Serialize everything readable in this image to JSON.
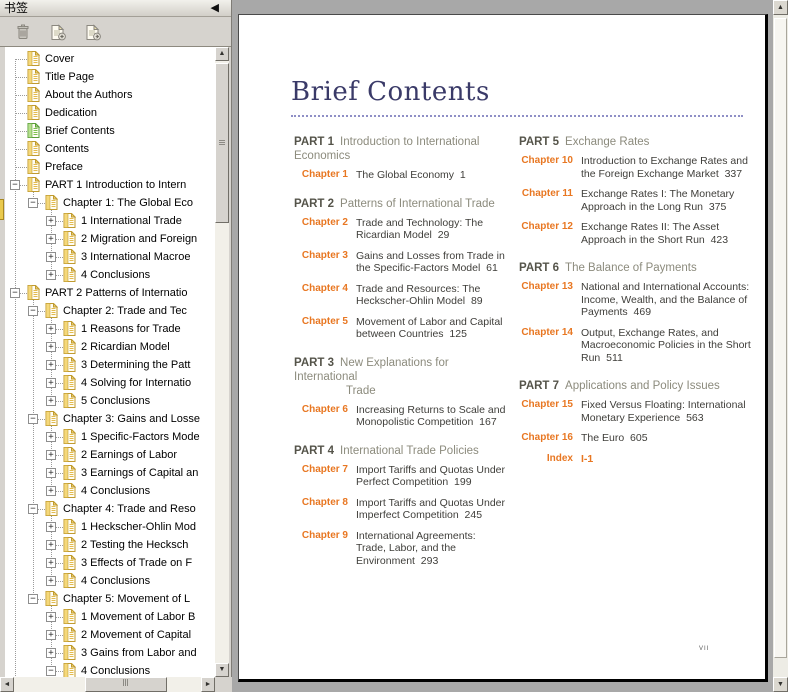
{
  "panel": {
    "title": "书签",
    "collapse_glyph": "◀",
    "toolbar_icons": [
      "delete-bookmark-icon",
      "add-bookmark-icon",
      "export-bookmark-icon"
    ],
    "tree": [
      {
        "label": "Cover",
        "level": 0,
        "expand": null
      },
      {
        "label": "Title Page",
        "level": 0,
        "expand": null
      },
      {
        "label": "About the Authors",
        "level": 0,
        "expand": null
      },
      {
        "label": "Dedication",
        "level": 0,
        "expand": null
      },
      {
        "label": "Brief Contents",
        "level": 0,
        "expand": null,
        "selected": true
      },
      {
        "label": "Contents",
        "level": 0,
        "expand": null
      },
      {
        "label": "Preface",
        "level": 0,
        "expand": null
      },
      {
        "label": "PART 1 Introduction to Intern",
        "level": 0,
        "expand": "minus"
      },
      {
        "label": "Chapter 1: The Global Eco",
        "level": 1,
        "expand": "minus"
      },
      {
        "label": "1 International Trade",
        "level": 2,
        "expand": "plus"
      },
      {
        "label": "2 Migration and Foreign",
        "level": 2,
        "expand": "plus"
      },
      {
        "label": "3 International Macroe",
        "level": 2,
        "expand": "plus"
      },
      {
        "label": "4 Conclusions",
        "level": 2,
        "expand": "plus"
      },
      {
        "label": "PART 2 Patterns of Internatio",
        "level": 0,
        "expand": "minus"
      },
      {
        "label": "Chapter 2: Trade and Tec",
        "level": 1,
        "expand": "minus"
      },
      {
        "label": "1 Reasons for Trade",
        "level": 2,
        "expand": "plus"
      },
      {
        "label": "2 Ricardian Model",
        "level": 2,
        "expand": "plus"
      },
      {
        "label": "3 Determining the Patt",
        "level": 2,
        "expand": "plus"
      },
      {
        "label": "4 Solving for Internatio",
        "level": 2,
        "expand": "plus"
      },
      {
        "label": "5 Conclusions",
        "level": 2,
        "expand": "plus"
      },
      {
        "label": "Chapter 3: Gains and Losse",
        "level": 1,
        "expand": "minus"
      },
      {
        "label": "1 Specific-Factors Mode",
        "level": 2,
        "expand": "plus"
      },
      {
        "label": "2 Earnings of Labor",
        "level": 2,
        "expand": "plus"
      },
      {
        "label": "3 Earnings of Capital an",
        "level": 2,
        "expand": "plus"
      },
      {
        "label": "4 Conclusions",
        "level": 2,
        "expand": "plus"
      },
      {
        "label": "Chapter 4: Trade and Reso",
        "level": 1,
        "expand": "minus"
      },
      {
        "label": "1 Heckscher-Ohlin Mod",
        "level": 2,
        "expand": "plus"
      },
      {
        "label": "2 Testing the Hecksch",
        "level": 2,
        "expand": "plus"
      },
      {
        "label": "3 Effects of Trade on F",
        "level": 2,
        "expand": "plus"
      },
      {
        "label": "4 Conclusions",
        "level": 2,
        "expand": "plus"
      },
      {
        "label": "Chapter 5: Movement of L",
        "level": 1,
        "expand": "minus"
      },
      {
        "label": "1 Movement of Labor B",
        "level": 2,
        "expand": "plus"
      },
      {
        "label": "2 Movement of Capital",
        "level": 2,
        "expand": "plus"
      },
      {
        "label": "3 Gains from Labor and",
        "level": 2,
        "expand": "plus"
      },
      {
        "label": "4 Conclusions",
        "level": 2,
        "expand": "minus"
      }
    ]
  },
  "document": {
    "page_title": "Brief Contents",
    "page_number": "vii",
    "parts": [
      {
        "column": "left",
        "num": "PART 1",
        "title": "Introduction to International",
        "title2": "Economics",
        "indent2": false,
        "chapters": [
          {
            "label": "Chapter 1",
            "text": "The Global Economy",
            "page": "1"
          }
        ]
      },
      {
        "column": "left",
        "num": "PART 2",
        "title": "Patterns of International Trade",
        "chapters": [
          {
            "label": "Chapter 2",
            "text": "Trade and Technology: The Ricardian Model",
            "page": "29"
          },
          {
            "label": "Chapter 3",
            "text": "Gains and Losses from Trade in the Specific-Factors Model",
            "page": "61"
          },
          {
            "label": "Chapter 4",
            "text": "Trade and Resources: The Heckscher-Ohlin Model",
            "page": "89"
          },
          {
            "label": "Chapter 5",
            "text": "Movement of Labor and Capital between Countries",
            "page": "125"
          }
        ]
      },
      {
        "column": "left",
        "num": "PART 3",
        "title": "New Explanations for International",
        "title2": "Trade",
        "indent2": true,
        "chapters": [
          {
            "label": "Chapter 6",
            "text": "Increasing Returns to Scale and Monopolistic Competition",
            "page": "167"
          }
        ]
      },
      {
        "column": "left",
        "num": "PART 4",
        "title": "International Trade Policies",
        "chapters": [
          {
            "label": "Chapter 7",
            "text": "Import Tariffs and Quotas Under Perfect Competition",
            "page": "199"
          },
          {
            "label": "Chapter 8",
            "text": "Import Tariffs and Quotas Under Imperfect Competition",
            "page": "245"
          },
          {
            "label": "Chapter 9",
            "text": "International Agreements: Trade, Labor, and the Environment",
            "page": "293"
          }
        ]
      },
      {
        "column": "right",
        "num": "PART 5",
        "title": "Exchange Rates",
        "chapters": [
          {
            "label": "Chapter 10",
            "text": "Introduction to Exchange Rates and the Foreign Exchange Market",
            "page": "337"
          },
          {
            "label": "Chapter 11",
            "text": "Exchange Rates I: The Monetary Approach in the Long Run",
            "page": "375"
          },
          {
            "label": "Chapter 12",
            "text": "Exchange Rates II: The Asset Approach in the Short Run",
            "page": "423"
          }
        ]
      },
      {
        "column": "right",
        "num": "PART 6",
        "title": "The Balance of Payments",
        "chapters": [
          {
            "label": "Chapter 13",
            "text": "National and International Accounts: Income, Wealth, and the Balance of Payments",
            "page": "469"
          },
          {
            "label": "Chapter 14",
            "text": "Output, Exchange Rates, and Macroeconomic Policies in the Short Run",
            "page": "511"
          }
        ]
      },
      {
        "column": "right",
        "num": "PART 7",
        "title": "Applications and Policy Issues",
        "chapters": [
          {
            "label": "Chapter 15",
            "text": "Fixed Versus Floating: International Monetary Experience",
            "page": "563"
          },
          {
            "label": "Chapter 16",
            "text": "The Euro",
            "page": "605"
          },
          {
            "label": "Index",
            "text": "I-1",
            "page": "",
            "accent": true
          }
        ]
      }
    ]
  },
  "colors": {
    "accent_orange": "#e87722",
    "part_number": "#55544a",
    "part_title": "#8c8b7d",
    "chapter_text": "#3f3e3a",
    "heading_blue": "#3a3a68",
    "selected_bookmark_green": "#6aa43c",
    "bookmark_gold": "#c09b30"
  }
}
